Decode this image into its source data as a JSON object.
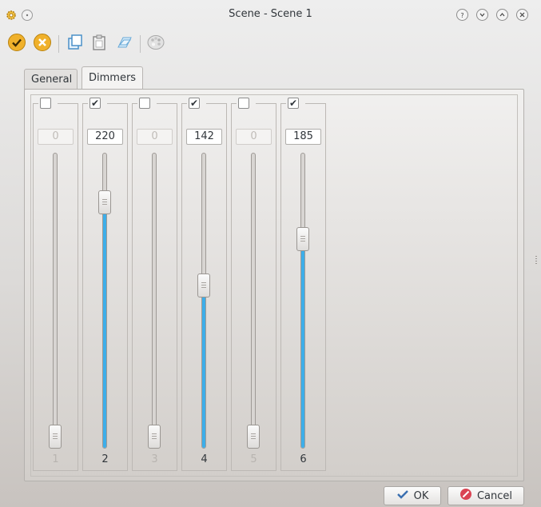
{
  "window": {
    "title": "Scene - Scene 1",
    "app_icon": "gear-icon",
    "controls": [
      "help-icon",
      "minimize-icon",
      "maximize-icon",
      "close-icon"
    ]
  },
  "toolbar": {
    "tools": [
      "enable-all-icon",
      "disable-all-icon",
      "copy-icon",
      "paste-icon",
      "copy-to-all-icon",
      "color-tool-icon"
    ]
  },
  "tabs": [
    {
      "label": "General",
      "active": false
    },
    {
      "label": "Dimmers",
      "active": true
    }
  ],
  "channels": [
    {
      "number": "1",
      "enabled": false,
      "value": "0",
      "level": 0
    },
    {
      "number": "2",
      "enabled": true,
      "value": "220",
      "level": 220
    },
    {
      "number": "3",
      "enabled": false,
      "value": "0",
      "level": 0
    },
    {
      "number": "4",
      "enabled": true,
      "value": "142",
      "level": 142
    },
    {
      "number": "5",
      "enabled": false,
      "value": "0",
      "level": 0
    },
    {
      "number": "6",
      "enabled": true,
      "value": "185",
      "level": 185
    }
  ],
  "slider_max": 255,
  "buttons": {
    "ok_label": "OK",
    "cancel_label": "Cancel"
  },
  "colors": {
    "accent": "#3daee9",
    "ok_icon": "#f0b12b",
    "cancel_icon": "#da4453"
  }
}
